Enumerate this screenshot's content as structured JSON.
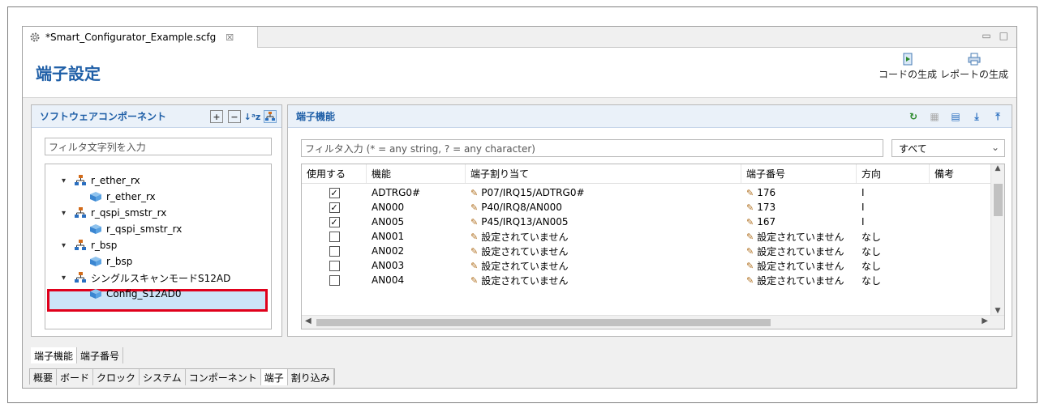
{
  "editor": {
    "tab_title": "*Smart_Configurator_Example.scfg",
    "tab_close": "☒",
    "min_btn": "▭",
    "max_btn": "□"
  },
  "header": {
    "title": "端子設定",
    "generate_code_label": "コードの生成",
    "generate_report_label": "レポートの生成"
  },
  "left_panel": {
    "title": "ソフトウェアコンポーネント",
    "filter_placeholder": "フィルタ文字列を入力",
    "tree": [
      {
        "label": "r_ether_rx",
        "level": 0,
        "expanded": true
      },
      {
        "label": "r_ether_rx",
        "level": 1
      },
      {
        "label": "r_qspi_smstr_rx",
        "level": 0,
        "expanded": true
      },
      {
        "label": "r_qspi_smstr_rx",
        "level": 1
      },
      {
        "label": "r_bsp",
        "level": 0,
        "expanded": true
      },
      {
        "label": "r_bsp",
        "level": 1
      },
      {
        "label": "シングルスキャンモードS12AD",
        "level": 0,
        "expanded": true
      },
      {
        "label": "Config_S12AD0",
        "level": 1,
        "selected": true
      }
    ]
  },
  "right_panel": {
    "title": "端子機能",
    "filter_placeholder": "フィルタ入力 (* = any string, ? = any character)",
    "filter_combo": "すべて",
    "columns": [
      "使用する",
      "機能",
      "端子割り当て",
      "端子番号",
      "方向",
      "備考"
    ],
    "rows": [
      {
        "use": true,
        "function": "ADTRG0#",
        "assign": "P07/IRQ15/ADTRG0#",
        "pin": "176",
        "dir": "I",
        "note": ""
      },
      {
        "use": true,
        "function": "AN000",
        "assign": "P40/IRQ8/AN000",
        "pin": "173",
        "dir": "I",
        "note": ""
      },
      {
        "use": true,
        "function": "AN005",
        "assign": "P45/IRQ13/AN005",
        "pin": "167",
        "dir": "I",
        "note": ""
      },
      {
        "use": false,
        "function": "AN001",
        "assign": "設定されていません",
        "pin": "設定されていません",
        "dir": "なし",
        "note": ""
      },
      {
        "use": false,
        "function": "AN002",
        "assign": "設定されていません",
        "pin": "設定されていません",
        "dir": "なし",
        "note": ""
      },
      {
        "use": false,
        "function": "AN003",
        "assign": "設定されていません",
        "pin": "設定されていません",
        "dir": "なし",
        "note": ""
      },
      {
        "use": false,
        "function": "AN004",
        "assign": "設定されていません",
        "pin": "設定されていません",
        "dir": "なし",
        "note": ""
      }
    ]
  },
  "view_tabs": [
    "端子機能",
    "端子番号"
  ],
  "page_tabs": [
    "概要",
    "ボード",
    "クロック",
    "システム",
    "コンポーネント",
    "端子",
    "割り込み"
  ],
  "active_page_tab": "端子",
  "colors": {
    "title": "#1f5fa7",
    "highlight_border": "#e0001b",
    "selection": "#cce4f7"
  }
}
